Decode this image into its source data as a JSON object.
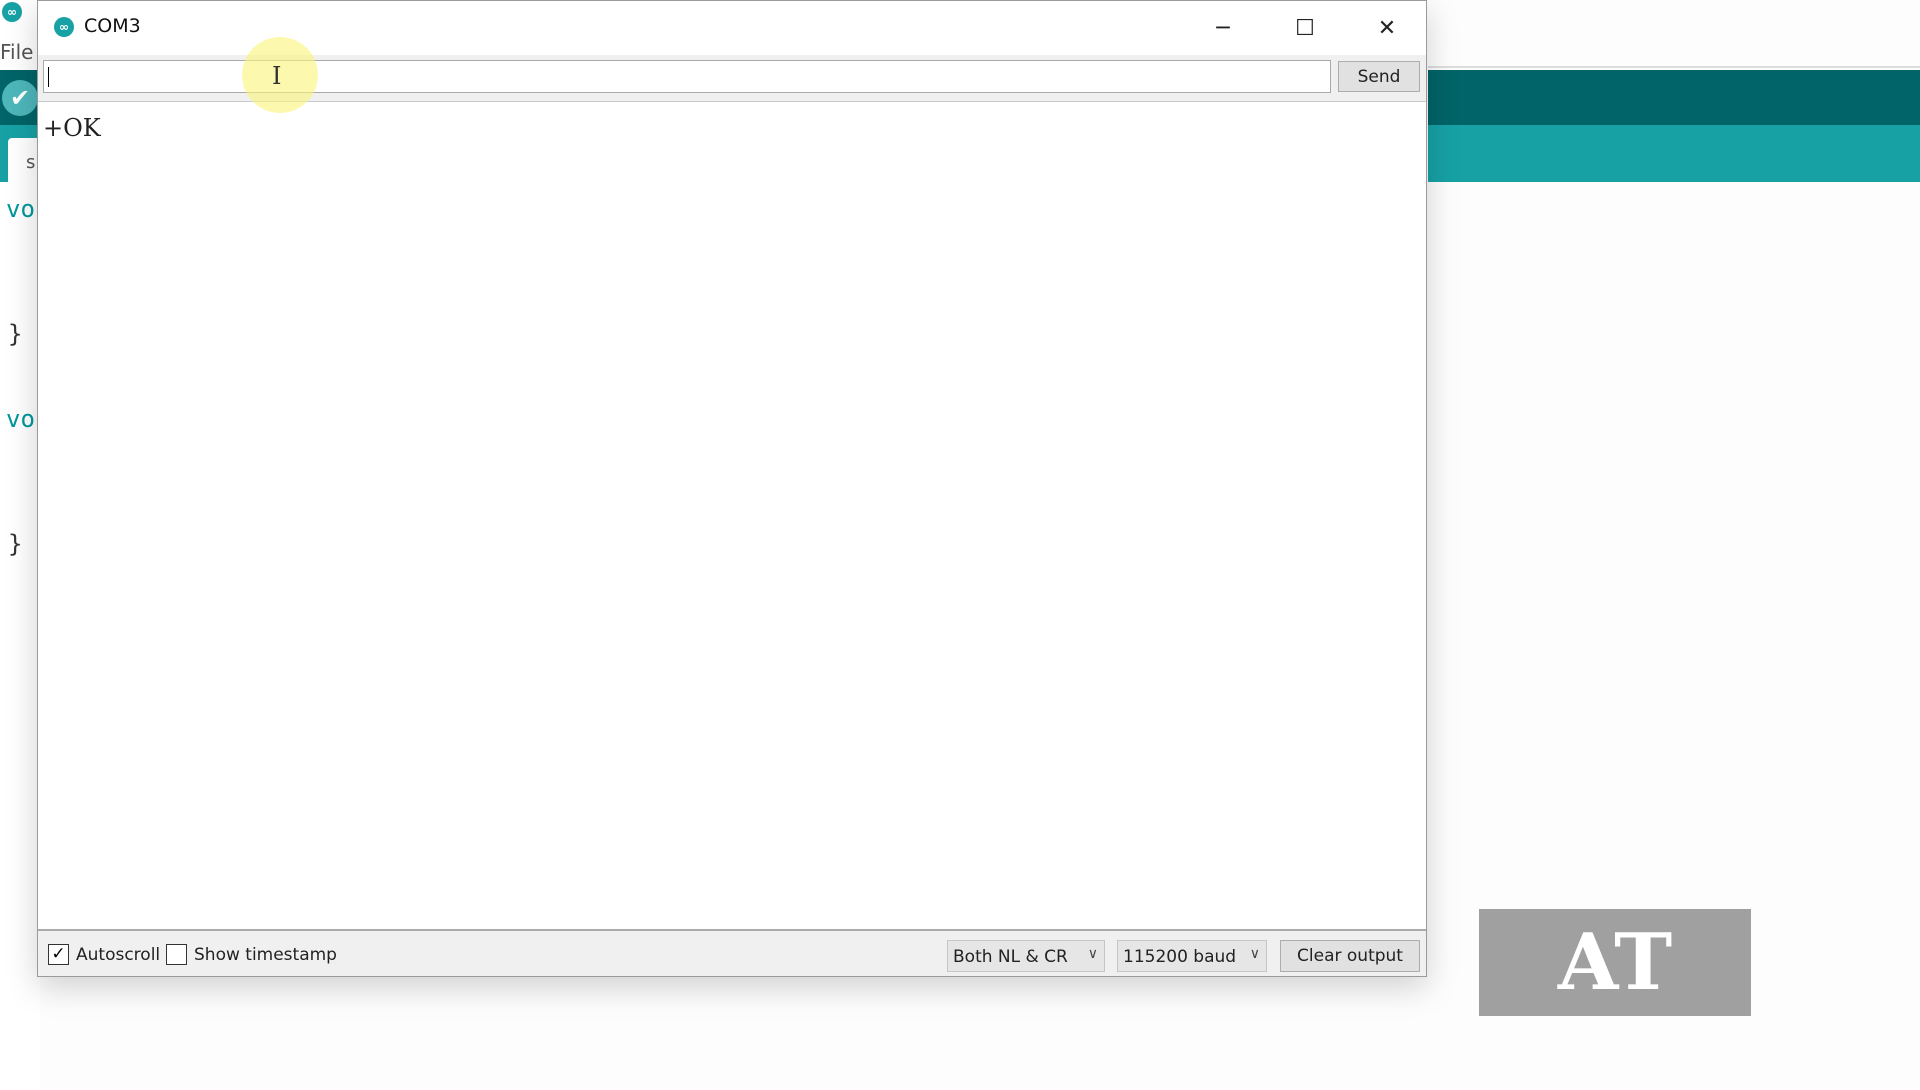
{
  "background_ide": {
    "menu_file": "File",
    "tab_label": "s",
    "code_lines": [
      "vo",
      "}",
      "vo",
      "}"
    ],
    "colors": {
      "teal_dark": "#006468",
      "teal_light": "#17a1a5"
    }
  },
  "window": {
    "title": "COM3",
    "icon": "arduino-icon",
    "controls": {
      "minimize": "─",
      "maximize": "☐",
      "close": "✕"
    }
  },
  "input": {
    "value": "",
    "send_label": "Send"
  },
  "output": {
    "lines": [
      "+OK"
    ]
  },
  "bottom": {
    "autoscroll_label": "Autoscroll",
    "autoscroll_checked": true,
    "timestamp_label": "Show timestamp",
    "timestamp_checked": false,
    "line_ending": "Both NL & CR",
    "baud": "115200 baud",
    "clear_label": "Clear output"
  },
  "overlay": {
    "badge_text": "AT"
  }
}
